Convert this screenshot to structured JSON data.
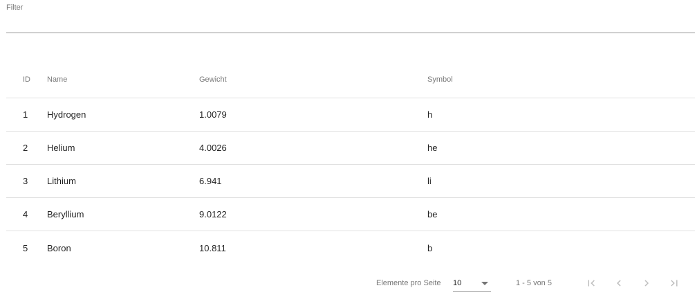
{
  "filter": {
    "label": "Filter",
    "value": ""
  },
  "table": {
    "headers": {
      "id": "ID",
      "name": "Name",
      "weight": "Gewicht",
      "symbol": "Symbol"
    },
    "rows": [
      {
        "id": "1",
        "name": "Hydrogen",
        "weight": "1.0079",
        "symbol": "h"
      },
      {
        "id": "2",
        "name": "Helium",
        "weight": "4.0026",
        "symbol": "he"
      },
      {
        "id": "3",
        "name": "Lithium",
        "weight": "6.941",
        "symbol": "li"
      },
      {
        "id": "4",
        "name": "Beryllium",
        "weight": "9.0122",
        "symbol": "be"
      },
      {
        "id": "5",
        "name": "Boron",
        "weight": "10.811",
        "symbol": "b"
      }
    ]
  },
  "paginator": {
    "items_per_page_label": "Elemente pro Seite",
    "page_size": "10",
    "range_label": "1 - 5 von 5",
    "icons": {
      "first": "first-page-icon",
      "prev": "chevron-left-icon",
      "next": "chevron-right-icon",
      "last": "last-page-icon"
    },
    "icon_color": "#bdbdbd"
  }
}
